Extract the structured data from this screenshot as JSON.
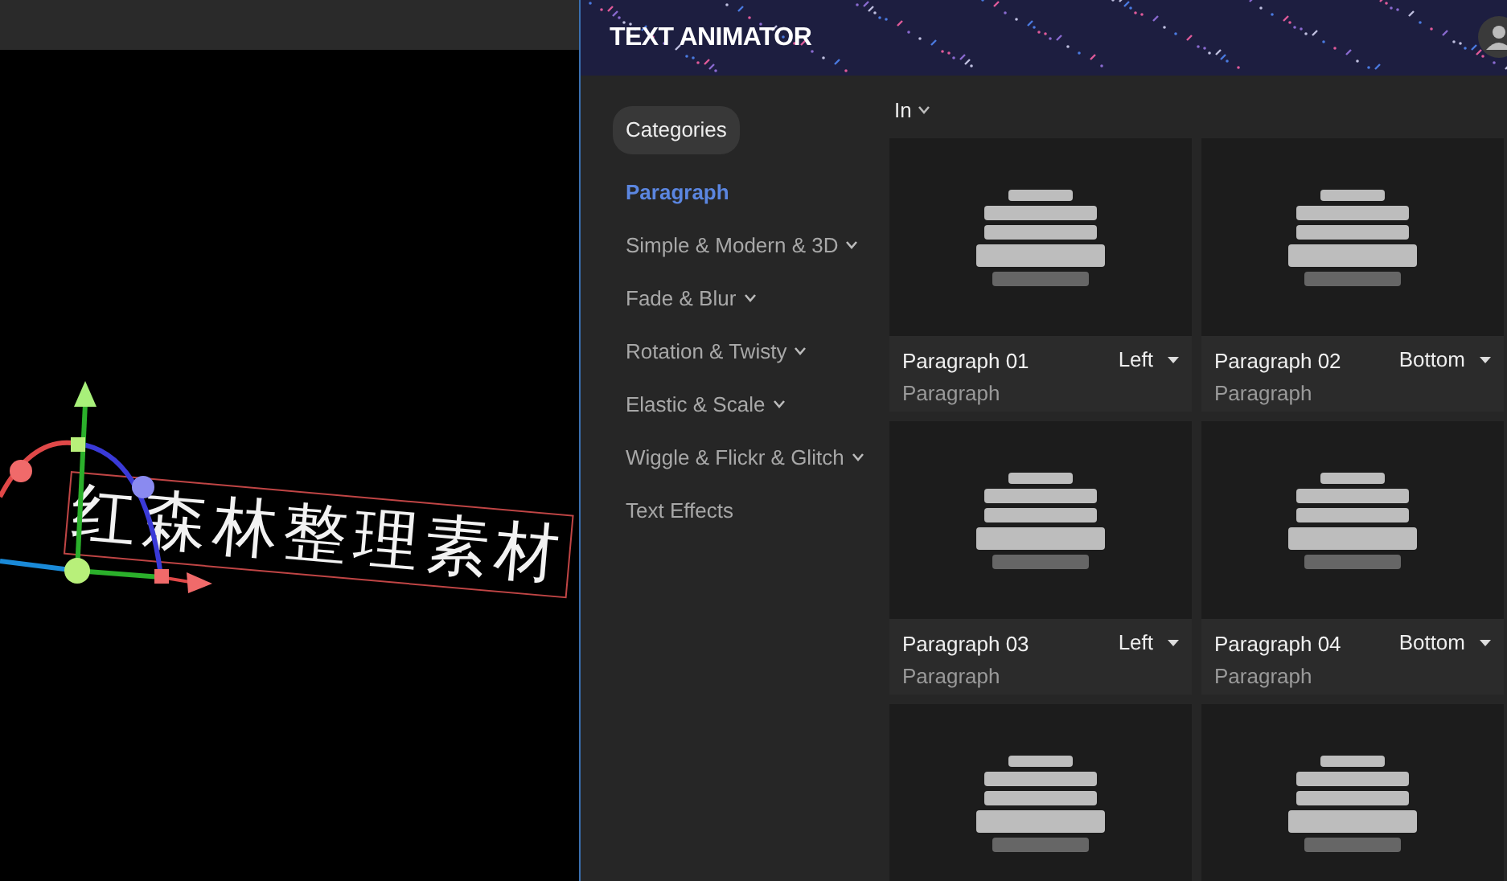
{
  "viewport": {
    "scene_text": "红森林整理素材"
  },
  "panel": {
    "title": "TEXT ANIMATOR",
    "categories_label": "Categories",
    "categories": [
      {
        "label": "Paragraph",
        "selected": true,
        "has_submenu": false
      },
      {
        "label": "Simple & Modern & 3D",
        "selected": false,
        "has_submenu": true
      },
      {
        "label": "Fade & Blur",
        "selected": false,
        "has_submenu": true
      },
      {
        "label": "Rotation & Twisty",
        "selected": false,
        "has_submenu": true
      },
      {
        "label": "Elastic & Scale",
        "selected": false,
        "has_submenu": true
      },
      {
        "label": "Wiggle & Flickr & Glitch",
        "selected": false,
        "has_submenu": true
      },
      {
        "label": "Text Effects",
        "selected": false,
        "has_submenu": false
      }
    ],
    "direction_filter": "In",
    "presets": [
      {
        "kind": "full",
        "name": "Paragraph 01",
        "category": "Paragraph",
        "direction": "Left"
      },
      {
        "kind": "full",
        "name": "Paragraph 02",
        "category": "Paragraph",
        "direction": "Bottom"
      },
      {
        "kind": "full",
        "name": "Paragraph 03",
        "category": "Paragraph",
        "direction": "Left"
      },
      {
        "kind": "full",
        "name": "Paragraph 04",
        "category": "Paragraph",
        "direction": "Bottom"
      },
      {
        "kind": "partial"
      },
      {
        "kind": "partial"
      }
    ]
  }
}
